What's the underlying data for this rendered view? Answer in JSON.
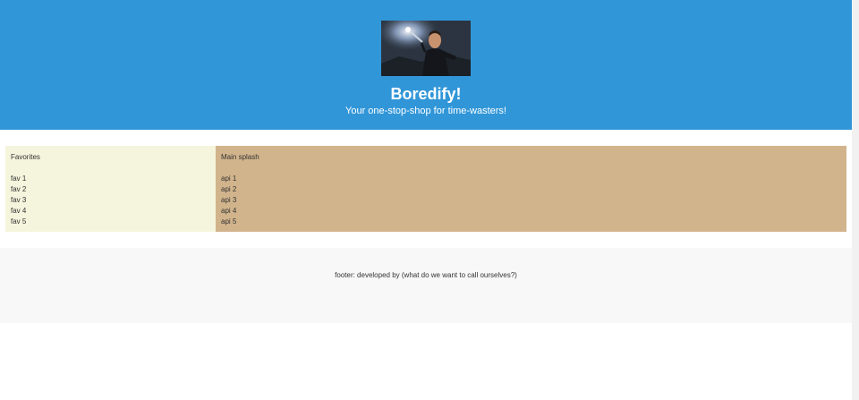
{
  "header": {
    "title": "Boredify!",
    "tagline": "Your one-stop-shop for time-wasters!",
    "background_color": "#3196d8"
  },
  "favorites": {
    "title": "Favorites",
    "items": [
      "fav 1",
      "fav 2",
      "fav 3",
      "fav 4",
      "fav 5"
    ],
    "background_color": "#f4f5dc"
  },
  "main_splash": {
    "title": "Main splash",
    "items": [
      "api 1",
      "api 2",
      "api 3",
      "api 4",
      "api 5"
    ],
    "background_color": "#d2b48c"
  },
  "footer": {
    "text": "footer: developed by (what do we want to call ourselves?)",
    "background_color": "#f8f8f8"
  }
}
